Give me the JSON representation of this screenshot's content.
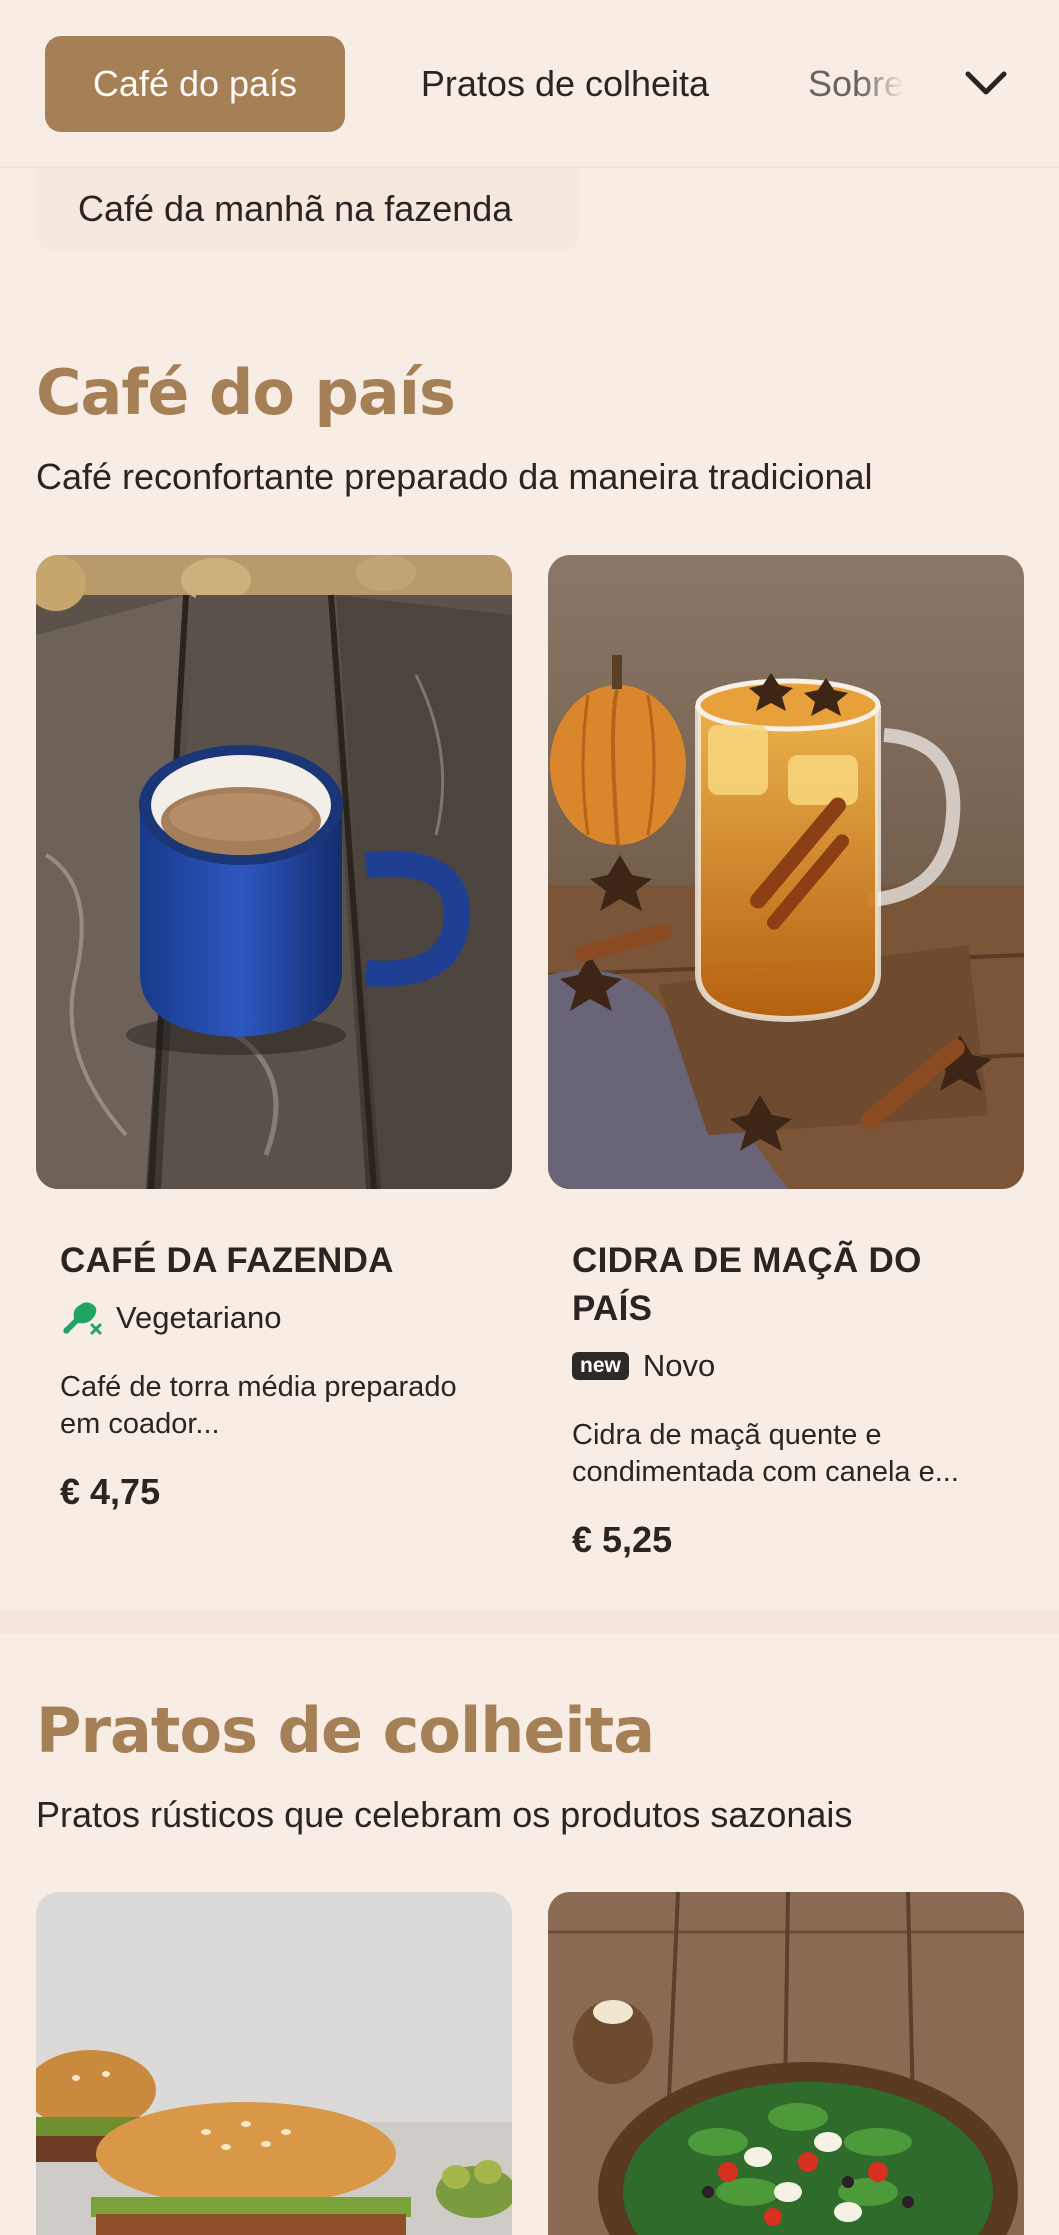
{
  "nav": {
    "tabs": [
      {
        "label": "Café do país",
        "active": true
      },
      {
        "label": "Pratos de colheita",
        "active": false
      },
      {
        "label": "Sobre",
        "active": false
      }
    ],
    "chevron_icon": "chevron-down-icon",
    "sub_pill_label": "Café da manhã na fazenda"
  },
  "sections": [
    {
      "title": "Café do país",
      "description": "Café reconfortante preparado da maneira tradicional",
      "items": [
        {
          "name": "CAFÉ DA FAZENDA",
          "tag": "Vegetariano",
          "tag_icon": "vegetarian-leg-icon",
          "description": "Café de torra média preparado em coador...",
          "price": "€ 4,75"
        },
        {
          "name": "CIDRA DE MAÇÃ DO PAÍS",
          "tag_badge": "new",
          "tag": "Novo",
          "description": "Cidra de maçã quente e condimentada com canela e...",
          "price": "€ 5,25"
        }
      ]
    },
    {
      "title": "Pratos de colheita",
      "description": "Pratos rústicos que celebram os produtos sazonais"
    }
  ],
  "colors": {
    "background": "#f8ede4",
    "accent": "#a57f56",
    "text": "#2a2522",
    "vegetarian_green": "#1fa463"
  }
}
